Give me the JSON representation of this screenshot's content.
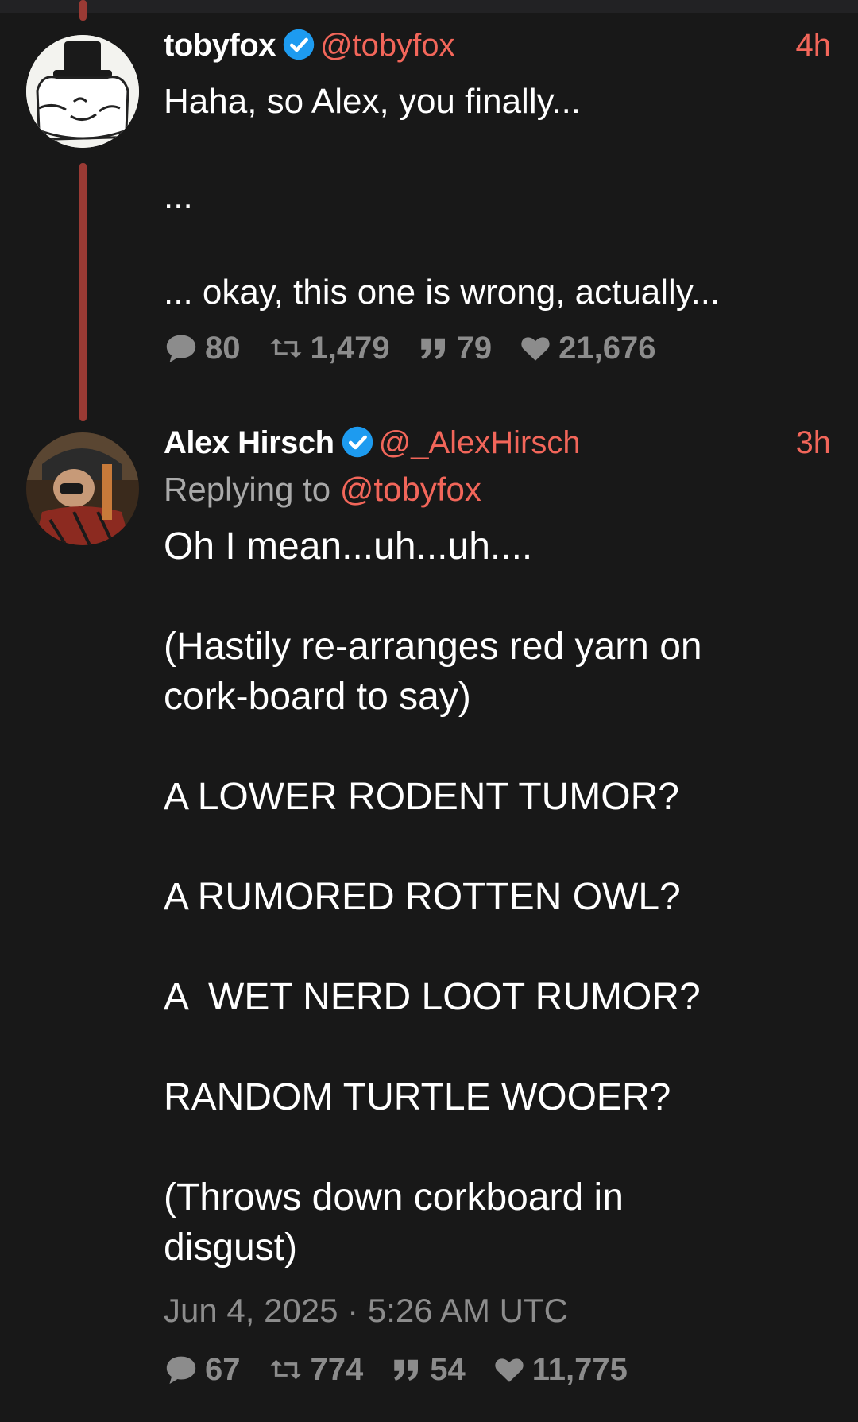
{
  "tweets": [
    {
      "name": "tobyfox",
      "handle": "@tobyfox",
      "time": "4h",
      "text": "Haha, so Alex, you finally...\n\n...\n\n... okay, this one is wrong, actually...",
      "stats": {
        "replies": "80",
        "retweets": "1,479",
        "quotes": "79",
        "likes": "21,676"
      }
    },
    {
      "name": "Alex Hirsch",
      "handle": "@_AlexHirsch",
      "time": "3h",
      "replying_prefix": "Replying to",
      "replying_handle": "@tobyfox",
      "text": "Oh I mean...uh...uh....\n\n(Hastily re-arranges red yarn on\ncork-board to say)\n\nA LOWER RODENT TUMOR?\n\nA RUMORED ROTTEN OWL?\n\nA  WET NERD LOOT RUMOR?\n\nRANDOM TURTLE WOOER?\n\n(Throws down corkboard in\ndisgust)",
      "date": "Jun 4, 2025 · 5:26 AM UTC",
      "stats": {
        "replies": "67",
        "retweets": "774",
        "quotes": "54",
        "likes": "11,775"
      }
    }
  ],
  "colors": {
    "background": "#181818",
    "accent": "#f2665a",
    "muted": "#8c8c8c",
    "verified": "#1d9bf0",
    "thread_line": "#9a3a34"
  },
  "icons": [
    "verified-badge-icon",
    "reply-icon",
    "retweet-icon",
    "quote-icon",
    "heart-icon"
  ]
}
